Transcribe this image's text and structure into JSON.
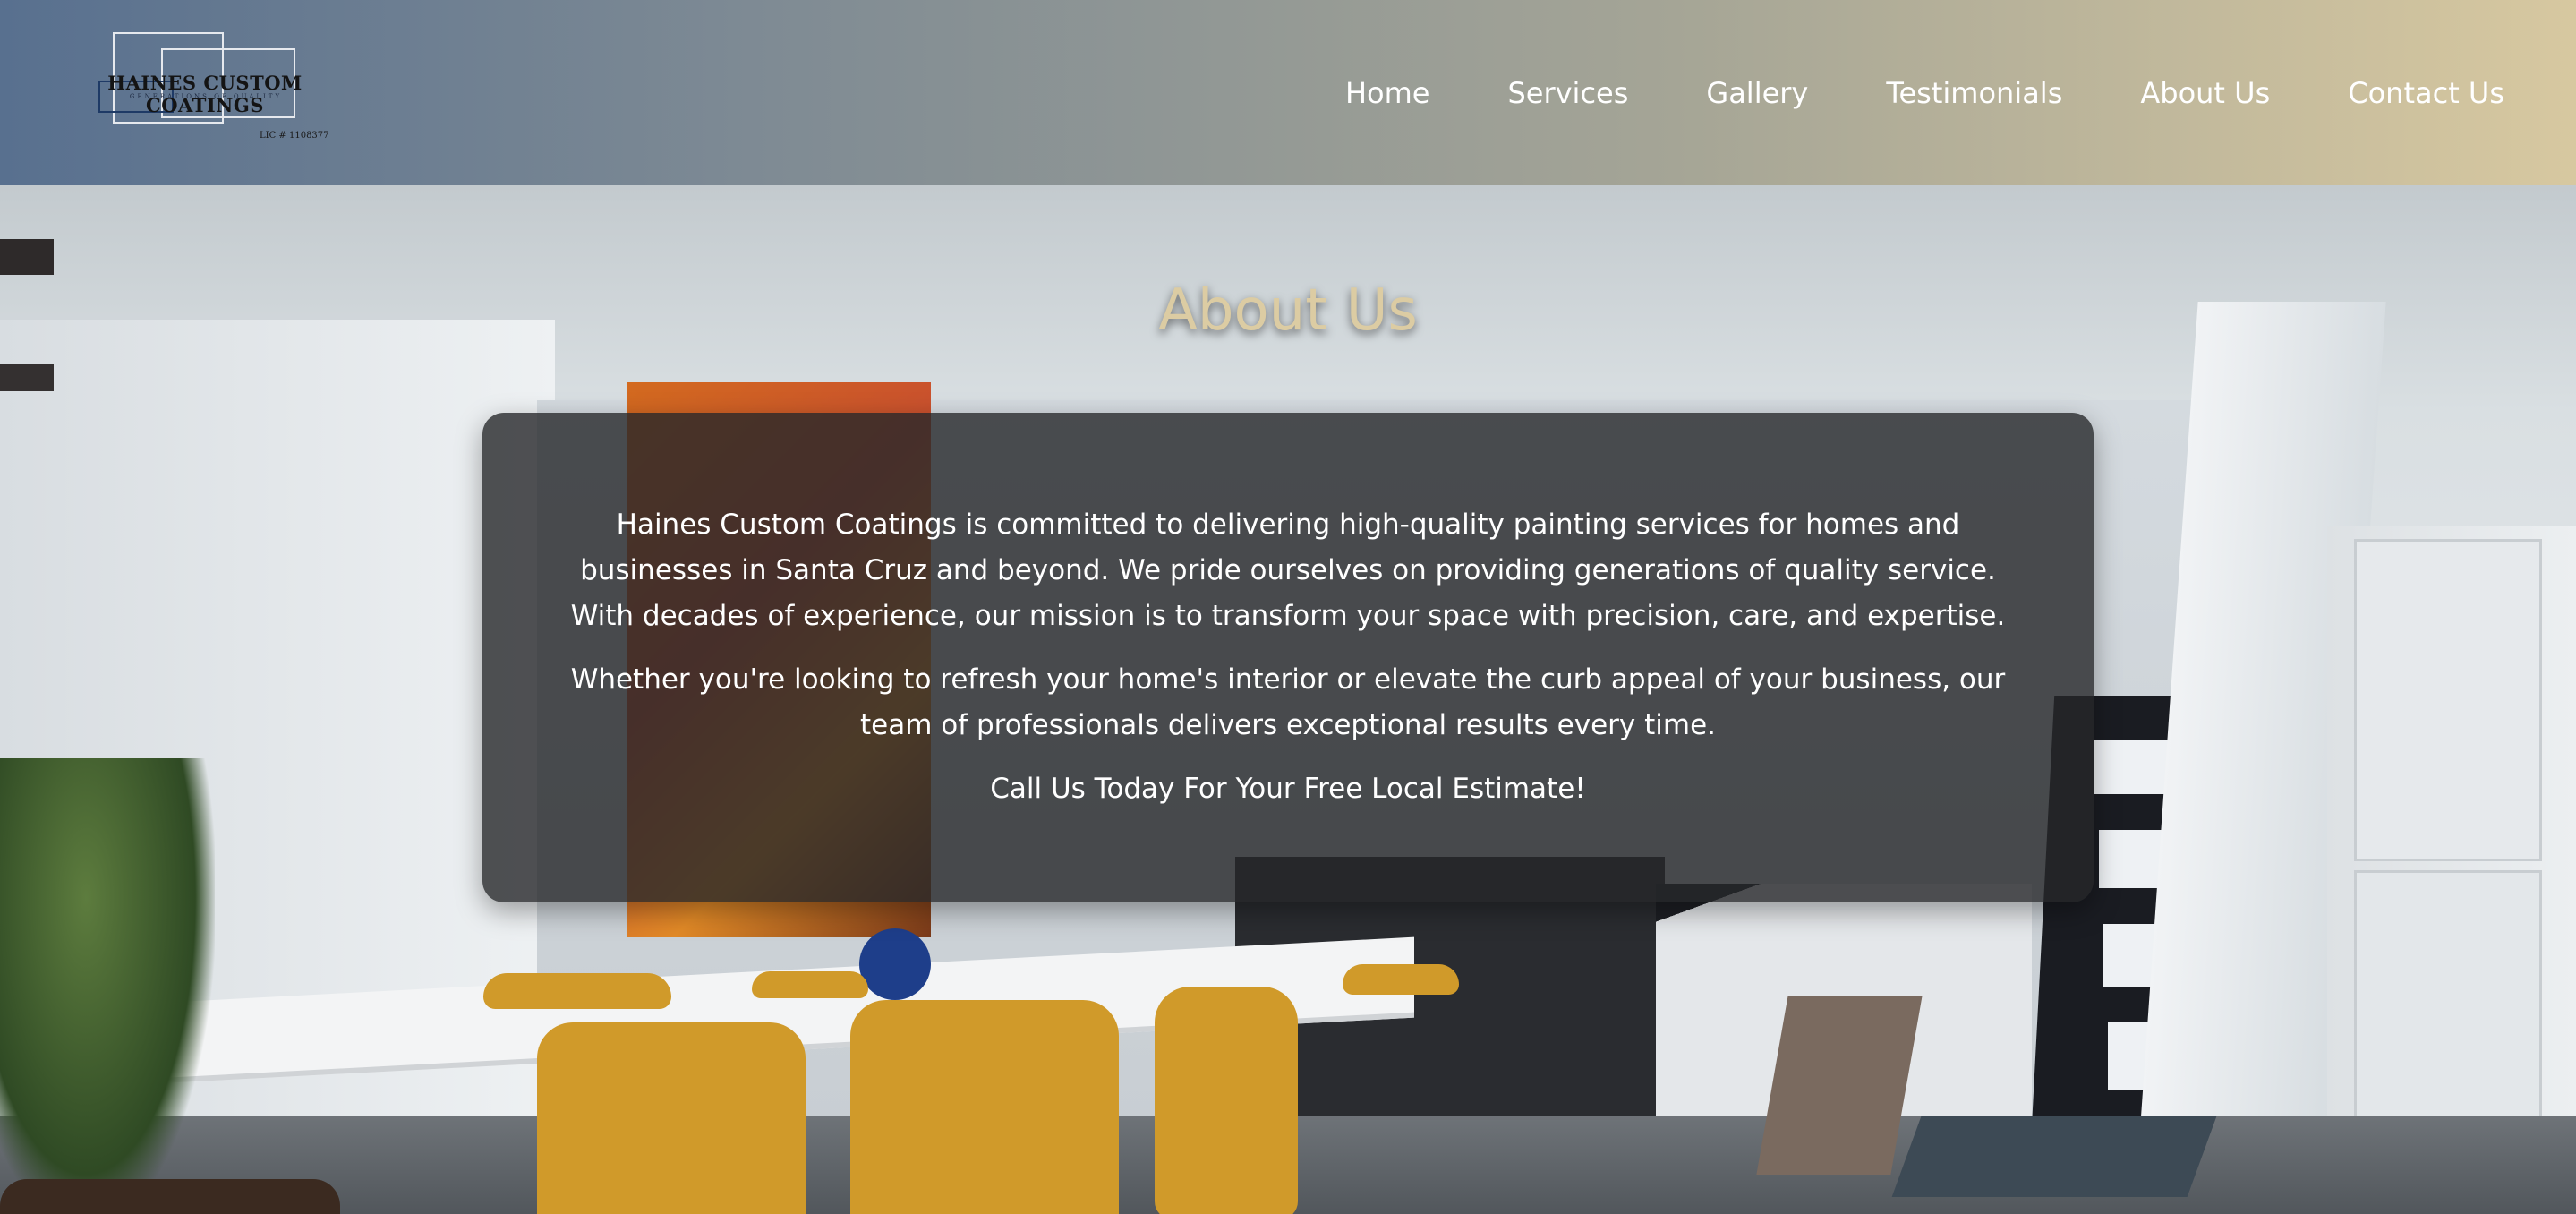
{
  "brand": {
    "name": "HAINES CUSTOM COATINGS",
    "tagline": "GENERATIONS OF QUALITY",
    "license": "LIC # 1108377"
  },
  "nav": {
    "items": [
      {
        "label": "Home"
      },
      {
        "label": "Services"
      },
      {
        "label": "Gallery"
      },
      {
        "label": "Testimonials"
      },
      {
        "label": "About Us"
      },
      {
        "label": "Contact Us"
      }
    ]
  },
  "about": {
    "title": "About Us",
    "paragraphs": [
      "Haines Custom Coatings is committed to delivering high-quality painting services for homes and businesses in Santa Cruz and beyond. We pride ourselves on providing generations of quality service. With decades of experience, our mission is to transform your space with precision, care, and expertise.",
      "Whether you're looking to refresh your home's interior or elevate the curb appeal of your business, our team of professionals delivers exceptional results every time.",
      "Call Us Today For Your Free Local Estimate!"
    ]
  },
  "colors": {
    "title_accent": "#dccca3",
    "card_background": "#262729",
    "header_left": "#58708f",
    "header_right": "#d7c8a0",
    "nav_text": "#ffffff"
  }
}
